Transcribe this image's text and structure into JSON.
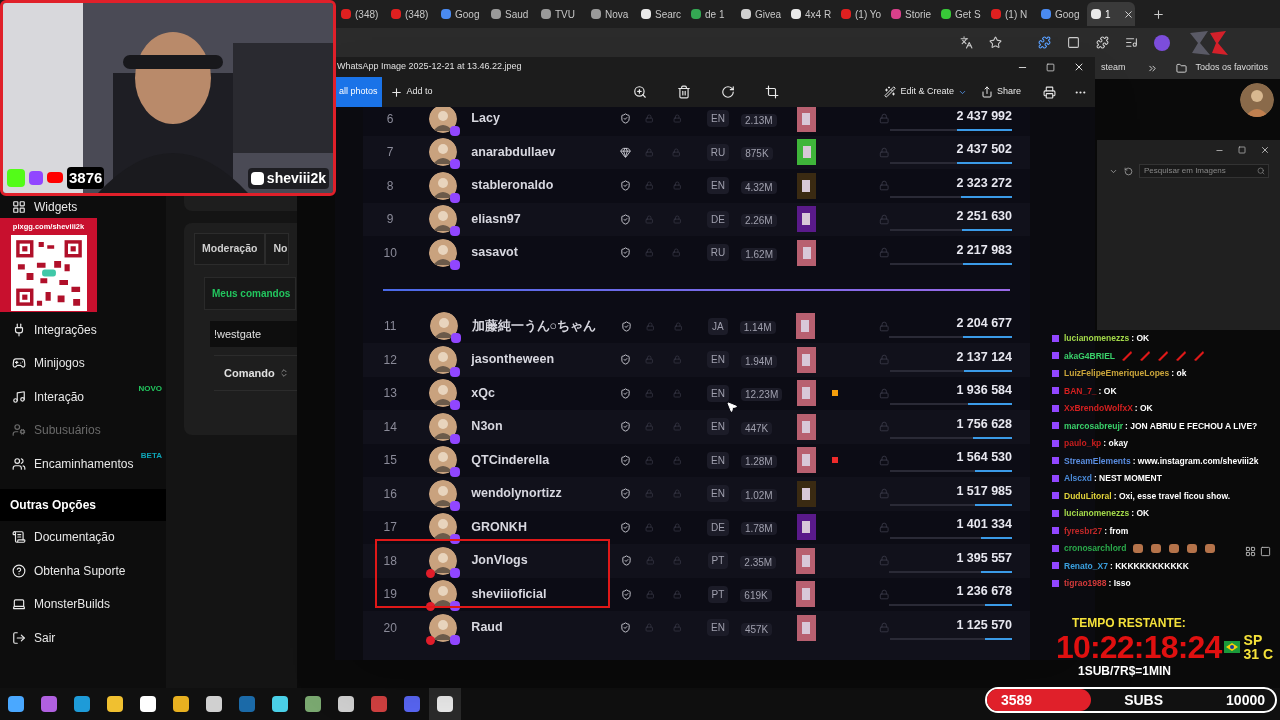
{
  "browser": {
    "tabs": [
      {
        "label": "(348)",
        "color": "#e02020",
        "selected": false
      },
      {
        "label": "(348)",
        "color": "#e02020",
        "selected": false
      },
      {
        "label": "Goog",
        "color": "#4a8af0",
        "selected": false
      },
      {
        "label": "Saud",
        "color": "#9a9a9a",
        "selected": false
      },
      {
        "label": "TVU",
        "color": "#9a9a9a",
        "selected": false
      },
      {
        "label": "Nova",
        "color": "#9a9a9a",
        "selected": false
      },
      {
        "label": "Searc",
        "color": "#e8e8e8",
        "selected": false
      },
      {
        "label": "de 1",
        "color": "#34a853",
        "selected": false
      },
      {
        "label": "Givea",
        "color": "#d0d0d0",
        "selected": false
      },
      {
        "label": "4x4 R",
        "color": "#e8e8e8",
        "selected": false
      },
      {
        "label": "(1) Yo",
        "color": "#e02020",
        "selected": false
      },
      {
        "label": "Storie",
        "color": "#d8408a",
        "selected": false
      },
      {
        "label": "Get S",
        "color": "#38c838",
        "selected": false
      },
      {
        "label": "(1) N",
        "color": "#e02020",
        "selected": false
      },
      {
        "label": "Goog",
        "color": "#4a8af0",
        "selected": false
      },
      {
        "label": "1",
        "color": "#e8e8e8",
        "selected": true
      }
    ],
    "bookmarks": [
      "steam",
      "Todos os favoritos"
    ]
  },
  "sidebar": {
    "top_items": [
      {
        "label": "Widgets",
        "disabled": false
      }
    ],
    "items": [
      {
        "label": "Integrações",
        "disabled": false
      },
      {
        "label": "Minijogos",
        "disabled": false
      },
      {
        "label": "Interação",
        "badge": {
          "text": "NOVO",
          "color": "#22c55e"
        },
        "disabled": false
      },
      {
        "label": "Subusuários",
        "disabled": true
      },
      {
        "label": "Encaminhamentos",
        "badge": {
          "text": "BETA",
          "color": "#0ea5b7"
        },
        "disabled": false
      }
    ],
    "section": "Outras Opções",
    "other_items": [
      "Documentação",
      "Obtenha Suporte",
      "MonsterBuilds",
      "Sair"
    ]
  },
  "panel": {
    "tabs": [
      "Moderação",
      "No"
    ],
    "button": "Meus comandos",
    "input_value": "!westgate",
    "column": "Comando"
  },
  "viewer": {
    "title": "WhatsApp Image 2025-12-21 at 13.46.22.jpeg",
    "back": "all photos",
    "add": "Add to",
    "edit": "Edit & Create",
    "share": "Share"
  },
  "leaderboard": {
    "top_rows": [
      {
        "rank": "6",
        "name": "Lacy",
        "kind": "shield",
        "lang": "EN",
        "followers": "2.13M",
        "thumbnail": {
          "color": "#b86070"
        },
        "live": false,
        "score": "2 437 992",
        "level": 0.45
      },
      {
        "rank": "7",
        "name": "anarabdullaev",
        "kind": "gem",
        "lang": "RU",
        "followers": "875K",
        "thumbnail": {
          "color": "#3fb53a"
        },
        "live": false,
        "score": "2 437 502",
        "level": 0.45
      },
      {
        "rank": "8",
        "name": "stableronaldo",
        "kind": "shield",
        "lang": "EN",
        "followers": "4.32M",
        "thumbnail": {
          "color": "#3a2a12"
        },
        "live": false,
        "score": "2 323 272",
        "level": 0.42
      },
      {
        "rank": "9",
        "name": "eliasn97",
        "kind": "shield",
        "lang": "DE",
        "followers": "2.26M",
        "thumbnail": {
          "color": "#5a1a8a"
        },
        "live": false,
        "score": "2 251 630",
        "level": 0.41
      },
      {
        "rank": "10",
        "name": "sasavot",
        "kind": "shield",
        "lang": "RU",
        "followers": "1.62M",
        "thumbnail": {
          "color": "#b86070"
        },
        "live": false,
        "score": "2 217 983",
        "level": 0.4
      }
    ],
    "rows": [
      {
        "rank": "11",
        "name": "加藤純一うん○ちゃん",
        "kind": "shield",
        "lang": "JA",
        "followers": "1.14M",
        "thumbnail": {
          "color": "#b86070"
        },
        "live": false,
        "score": "2 204 677",
        "level": 0.4
      },
      {
        "rank": "12",
        "name": "jasontheween",
        "kind": "shield",
        "lang": "EN",
        "followers": "1.94M",
        "thumbnail": {
          "color": "#b86070"
        },
        "live": false,
        "score": "2 137 124",
        "level": 0.39
      },
      {
        "rank": "13",
        "name": "xQc",
        "kind": "shield",
        "lang": "EN",
        "followers": "12.23M",
        "thumbnail": {
          "color": "#b86070"
        },
        "marker": {
          "color": "#f59e0b"
        },
        "live": false,
        "score": "1 936 584",
        "level": 0.36
      },
      {
        "rank": "14",
        "name": "N3on",
        "kind": "shield",
        "lang": "EN",
        "followers": "447K",
        "thumbnail": {
          "color": "#b86070"
        },
        "live": false,
        "score": "1 756 628",
        "level": 0.32
      },
      {
        "rank": "15",
        "name": "QTCinderella",
        "kind": "shield",
        "lang": "EN",
        "followers": "1.28M",
        "thumbnail": {
          "color": "#b86070"
        },
        "marker": {
          "color": "#ef2b2b"
        },
        "live": false,
        "score": "1 564 530",
        "level": 0.3
      },
      {
        "rank": "16",
        "name": "wendolynortizz",
        "kind": "shield",
        "lang": "EN",
        "followers": "1.02M",
        "thumbnail": {
          "color": "#3a2a12"
        },
        "live": false,
        "score": "1 517 985",
        "level": 0.3
      },
      {
        "rank": "17",
        "name": "GRONKH",
        "kind": "shield",
        "lang": "DE",
        "followers": "1.78M",
        "thumbnail": {
          "color": "#5a1a8a"
        },
        "live": false,
        "score": "1 401 334",
        "level": 0.25
      },
      {
        "rank": "18",
        "name": "JonVlogs",
        "kind": "shield",
        "lang": "PT",
        "followers": "2.35M",
        "thumbnail": {
          "color": "#b86070"
        },
        "live": true,
        "score": "1 395 557",
        "level": 0.25
      },
      {
        "rank": "19",
        "name": "sheviiioficial",
        "kind": "shield",
        "lang": "PT",
        "followers": "619K",
        "thumbnail": {
          "color": "#b86070"
        },
        "live": true,
        "score": "1 236 678",
        "level": 0.22
      },
      {
        "rank": "20",
        "name": "Raud",
        "kind": "shield",
        "lang": "EN",
        "followers": "457K",
        "thumbnail": {
          "color": "#b86070"
        },
        "live": true,
        "score": "1 125 570",
        "level": 0.22
      }
    ]
  },
  "search_window": {
    "placeholder": "Pesquisar em Imagens"
  },
  "webcam": {
    "viewers": "3876",
    "handle": "sheviii2k"
  },
  "qr": {
    "label": "pixgg.com/sheviii2k"
  },
  "chat": [
    {
      "user": "lucianomenezzs",
      "color": "#a3d94a",
      "kind": "text",
      "text": ": OK"
    },
    {
      "user": "akaG4BRIEL",
      "color": "#3ad16a",
      "kind": "emotes",
      "emotes": [
        {
          "kind": "stick"
        },
        {
          "kind": "stick"
        },
        {
          "kind": "stick"
        },
        {
          "kind": "stick"
        },
        {
          "kind": "stick"
        }
      ]
    },
    {
      "user": "LuizFelipeEmeriqueLopes",
      "color": "#c9a43a",
      "kind": "text",
      "text": ": ok"
    },
    {
      "user": "BAN_7_",
      "color": "#d42020",
      "kind": "text",
      "text": ": OK"
    },
    {
      "user": "XxBrendoWolfxX",
      "color": "#d42020",
      "kind": "text",
      "text": ": OK"
    },
    {
      "user": "marcosabreujr",
      "color": "#3ad16a",
      "kind": "text",
      "text": ": JON ABRIU E FECHOU A LIVE?"
    },
    {
      "user": "paulo_kp",
      "color": "#c81e1e",
      "kind": "text",
      "text": ": okay"
    },
    {
      "user": "StreamElements",
      "color": "#5a8de0",
      "kind": "text",
      "text": ": www.instagram.com/sheviii2k"
    },
    {
      "user": "Alscxd",
      "color": "#4a8ad8",
      "kind": "text",
      "text": ": NEST MOMENT"
    },
    {
      "user": "DuduLitoral",
      "color": "#e0d23a",
      "kind": "text",
      "text": ": Oxi, esse travel ficou show."
    },
    {
      "user": "lucianomenezzs",
      "color": "#a3d94a",
      "kind": "text",
      "text": ": OK"
    },
    {
      "user": "fyresbr27",
      "color": "#c02828",
      "kind": "text",
      "text": ": from"
    },
    {
      "user": "cronosarchlord",
      "color": "#2aa84a",
      "kind": "emotes",
      "emotes": [
        {
          "kind": "fist"
        },
        {
          "kind": "fist"
        },
        {
          "kind": "fist"
        },
        {
          "kind": "fist"
        },
        {
          "kind": "fist"
        }
      ]
    },
    {
      "user": "Renato_X7",
      "color": "#3aa0e0",
      "kind": "text",
      "text": ": KKKKKKKKKKKK"
    },
    {
      "user": "tigrao1988",
      "color": "#d23a3a",
      "kind": "text",
      "text": ": Isso"
    }
  ],
  "timer": {
    "label": "TEMPO RESTANTE:",
    "time": "10:22:18:24",
    "city": "SP",
    "temp": "31 C",
    "rate": "1SUB/7R$=1MIN"
  },
  "subs_goal": {
    "current": "3589",
    "label": "SUBS",
    "goal": "10000",
    "level": 0.36
  }
}
